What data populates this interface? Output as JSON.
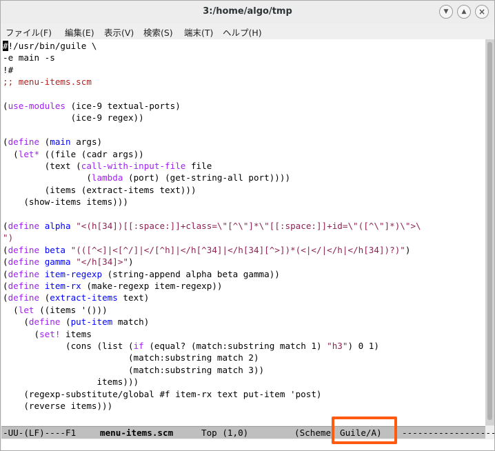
{
  "window": {
    "title": "3:/home/algo/tmp",
    "min_icon": "chevron-down-icon",
    "max_icon": "chevron-up-icon",
    "close_icon": "close-icon"
  },
  "menu": {
    "items": [
      "ファイル(F)",
      "編集(E)",
      "表示(V)",
      "検索(S)",
      "端末(T)",
      "ヘルプ(H)"
    ]
  },
  "editor": {
    "lines": [
      [
        [
          "#",
          "cursor"
        ],
        [
          "!/usr/bin/guile \\",
          ""
        ]
      ],
      [
        [
          "-e main -s",
          ""
        ]
      ],
      [
        [
          "!#",
          ""
        ]
      ],
      [
        [
          ";; menu-items.scm",
          "cmt"
        ]
      ],
      [],
      [
        [
          "(",
          ""
        ],
        [
          "use-modules",
          "kw"
        ],
        [
          " (ice-9 textual-ports)",
          ""
        ]
      ],
      [
        [
          "             (ice-9 regex))",
          ""
        ]
      ],
      [],
      [
        [
          "(",
          ""
        ],
        [
          "define",
          "kw"
        ],
        [
          " (",
          ""
        ],
        [
          "main",
          "fn"
        ],
        [
          " args)",
          ""
        ]
      ],
      [
        [
          "  (",
          ""
        ],
        [
          "let*",
          "kw"
        ],
        [
          " ((file (cadr args))",
          ""
        ]
      ],
      [
        [
          "        (text (",
          ""
        ],
        [
          "call-with-input-file",
          "kw"
        ],
        [
          " file",
          ""
        ]
      ],
      [
        [
          "                (",
          ""
        ],
        [
          "lambda",
          "kw"
        ],
        [
          " (port) (get-string-all port))))",
          ""
        ]
      ],
      [
        [
          "        (items (extract-items text)))",
          ""
        ]
      ],
      [
        [
          "    (show-items items)))",
          ""
        ]
      ],
      [],
      [
        [
          "(",
          ""
        ],
        [
          "define",
          "kw"
        ],
        [
          " ",
          ""
        ],
        [
          "alpha",
          "fn"
        ],
        [
          " ",
          ""
        ],
        [
          "\"<(h[34])[[:space:]]+class=\\\"[^\\\"]*\\\"[[:space:]]+id=\\\"([^\\\"]*)\\\">\\",
          "str"
        ]
      ],
      [
        [
          "\")",
          "str"
        ]
      ],
      [
        [
          "(",
          ""
        ],
        [
          "define",
          "kw"
        ],
        [
          " ",
          ""
        ],
        [
          "beta",
          "fn"
        ],
        [
          " ",
          ""
        ],
        [
          "\"(([^<]|<[^/]|</[^h]|</h[^34]|</h[34][^>])*(<|</|</h|</h[34])?)\"",
          "str"
        ],
        [
          ")",
          ""
        ]
      ],
      [
        [
          "(",
          ""
        ],
        [
          "define",
          "kw"
        ],
        [
          " ",
          ""
        ],
        [
          "gamma",
          "fn"
        ],
        [
          " ",
          ""
        ],
        [
          "\"</h[34]>\"",
          "str"
        ],
        [
          ")",
          ""
        ]
      ],
      [
        [
          "(",
          ""
        ],
        [
          "define",
          "kw"
        ],
        [
          " ",
          ""
        ],
        [
          "item-regexp",
          "fn"
        ],
        [
          " (string-append alpha beta gamma))",
          ""
        ]
      ],
      [
        [
          "(",
          ""
        ],
        [
          "define",
          "kw"
        ],
        [
          " ",
          ""
        ],
        [
          "item-rx",
          "fn"
        ],
        [
          " (make-regexp item-regexp))",
          ""
        ]
      ],
      [
        [
          "(",
          ""
        ],
        [
          "define",
          "kw"
        ],
        [
          " (",
          ""
        ],
        [
          "extract-items",
          "fn"
        ],
        [
          " text)",
          ""
        ]
      ],
      [
        [
          "  (",
          ""
        ],
        [
          "let",
          "kw"
        ],
        [
          " ((items '()))",
          ""
        ]
      ],
      [
        [
          "    (",
          ""
        ],
        [
          "define",
          "kw"
        ],
        [
          " (",
          ""
        ],
        [
          "put-item",
          "fn"
        ],
        [
          " match)",
          ""
        ]
      ],
      [
        [
          "      (",
          ""
        ],
        [
          "set!",
          "kw"
        ],
        [
          " items",
          ""
        ]
      ],
      [
        [
          "            (cons (list (",
          ""
        ],
        [
          "if",
          "kw"
        ],
        [
          " (equal? (match:substring match 1) ",
          ""
        ],
        [
          "\"h3\"",
          "str"
        ],
        [
          ") 0 1)",
          ""
        ]
      ],
      [
        [
          "                        (match:substring match 2)",
          ""
        ]
      ],
      [
        [
          "                        (match:substring match 3))",
          ""
        ]
      ],
      [
        [
          "                  items)))",
          ""
        ]
      ],
      [
        [
          "    (regexp-substitute/global #f item-rx text put-item 'post)",
          ""
        ]
      ],
      [
        [
          "    (reverse items)))",
          ""
        ]
      ]
    ]
  },
  "modeline": {
    "status": "-UU-(LF)----F1",
    "buffer": "menu-items.scm",
    "position": "Top (1,0)",
    "mode_prefix": "(Scheme",
    "mode_highlight": "Guile/A)",
    "trailer": "------------------"
  }
}
